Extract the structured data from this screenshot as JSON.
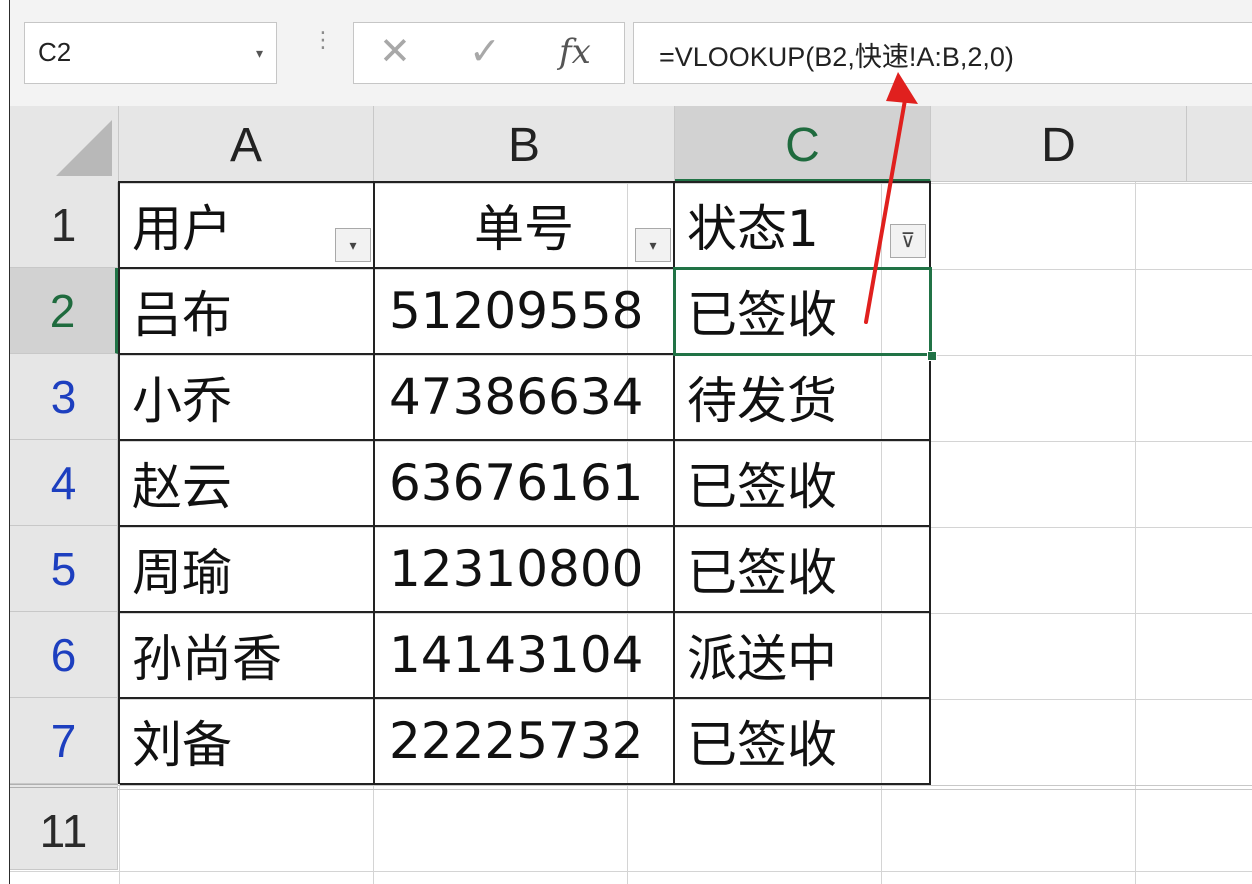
{
  "formula_bar": {
    "name_box": "C2",
    "name_box_dropdown": "▾",
    "grip": "⋮",
    "cancel_icon": "✕",
    "enter_icon": "✓",
    "fx_label": "fx",
    "formula": "=VLOOKUP(B2,快速!A:B,2,0)"
  },
  "columns": [
    "A",
    "B",
    "C",
    "D"
  ],
  "active_cell": "C2",
  "rows": [
    {
      "row": "1",
      "cells": [
        "用户",
        "单号",
        "状态1"
      ]
    },
    {
      "row": "2",
      "cells": [
        "吕布",
        "51209558",
        "已签收"
      ]
    },
    {
      "row": "3",
      "cells": [
        "小乔",
        "47386634",
        "待发货"
      ]
    },
    {
      "row": "4",
      "cells": [
        "赵云",
        "63676161",
        "已签收"
      ]
    },
    {
      "row": "5",
      "cells": [
        "周瑜",
        "12310800",
        "已签收"
      ]
    },
    {
      "row": "6",
      "cells": [
        "孙尚香",
        "14143104",
        "派送中"
      ]
    },
    {
      "row": "7",
      "cells": [
        "刘备",
        "22225732",
        "已签收"
      ]
    },
    {
      "row": "11",
      "cells": [
        "",
        "",
        ""
      ]
    }
  ],
  "filter_buttons": {
    "dropdown_icon": "▾",
    "filter_active_icon": "⊽"
  },
  "colors": {
    "selection": "#217346",
    "arrow": "#e0201e",
    "filtered_row_number": "#1d3fbf"
  }
}
